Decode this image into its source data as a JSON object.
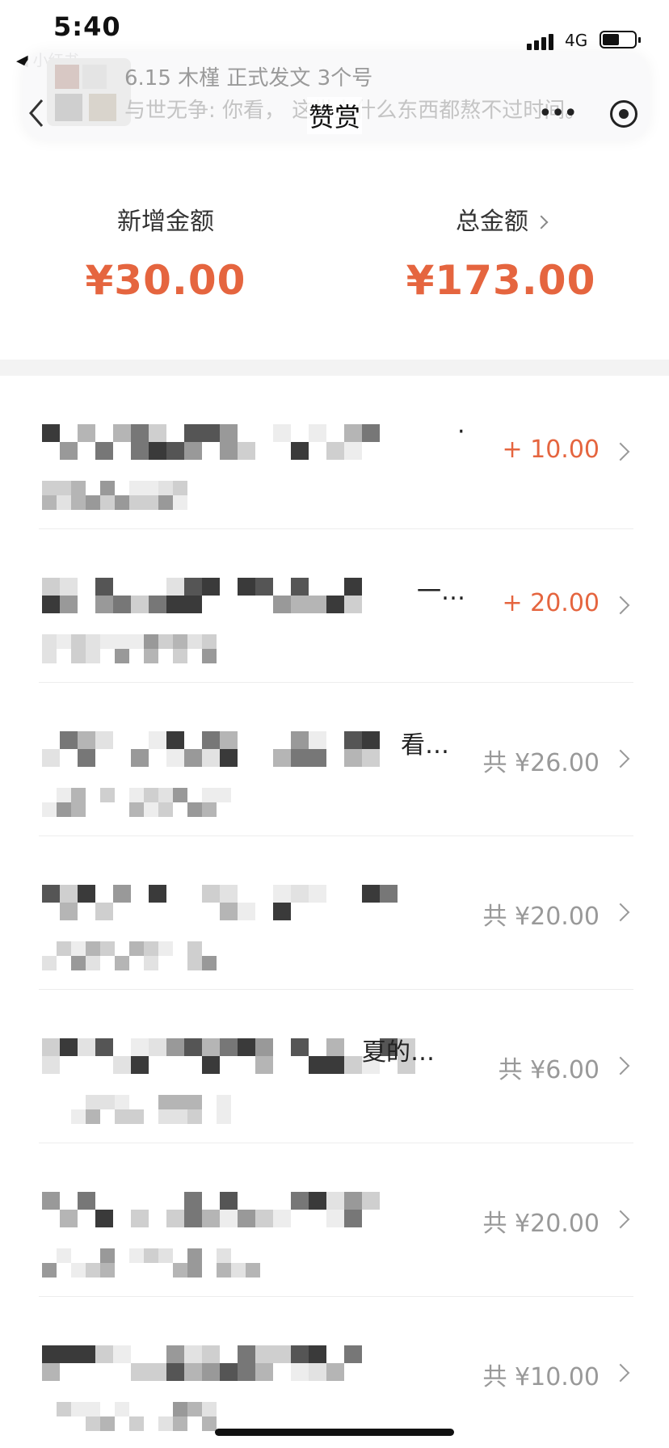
{
  "status_bar": {
    "time": "5:40",
    "back_app": "◀ 小红书",
    "network": "4G"
  },
  "banner": {
    "title": "6.15 木槿 正式发文 3个号",
    "message": "与世无争: 你看， 这世上什么东西都熬不过时间。"
  },
  "nav": {
    "title": "赞赏",
    "more": "•••"
  },
  "summary": {
    "new_amount_label": "新增金额",
    "new_amount_value": "¥30.00",
    "total_amount_label": "总金额",
    "total_amount_value": "¥173.00"
  },
  "rows": [
    {
      "suffix": "·",
      "amount": "+ 10.00",
      "kind": "plus"
    },
    {
      "suffix": "一…",
      "amount": "+ 20.00",
      "kind": "plus"
    },
    {
      "suffix": "看…",
      "amount": "共 ¥26.00",
      "kind": "total"
    },
    {
      "suffix": "",
      "amount": "共 ¥20.00",
      "kind": "total"
    },
    {
      "suffix": "夏的…",
      "amount": "共 ¥6.00",
      "kind": "total"
    },
    {
      "suffix": "",
      "amount": "共 ¥20.00",
      "kind": "total"
    },
    {
      "suffix": "",
      "amount": "共 ¥10.00",
      "kind": "total"
    }
  ]
}
